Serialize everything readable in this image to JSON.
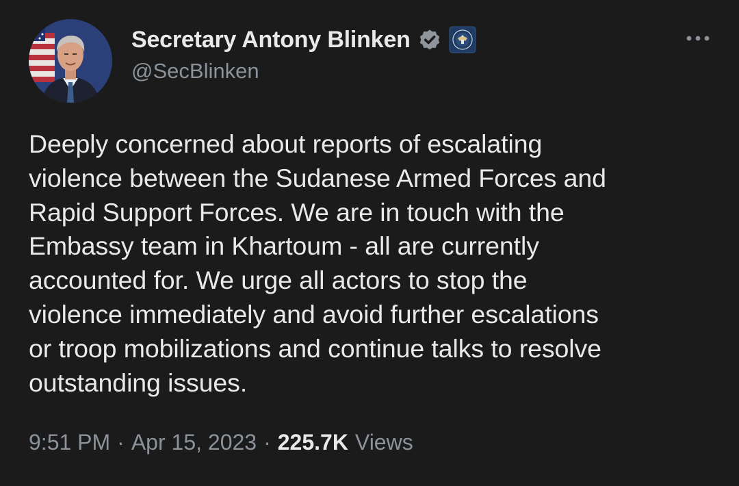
{
  "author": {
    "display_name": "Secretary Antony Blinken",
    "handle": "@SecBlinken",
    "verified_badge_icon": "verified-gray-badge-icon",
    "affiliation_icon": "us-state-department-seal-icon"
  },
  "tweet": {
    "text": "Deeply concerned about reports of escalating\nviolence between the Sudanese Armed Forces and\nRapid Support Forces. We are in touch with the\nEmbassy team in Khartoum - all are currently\naccounted for. We urge all actors to stop the\nviolence immediately and avoid further escalations\nor troop mobilizations and continue talks to resolve\noutstanding issues.",
    "time": "9:51 PM",
    "separator": "·",
    "date": "Apr 15, 2023",
    "views_count": "225.7K",
    "views_label": "Views"
  },
  "menu": {
    "icon": "more-options-icon"
  },
  "colors": {
    "background": "#1b1b1b",
    "primary_text": "#e7e9ea",
    "secondary_text": "#8b9299",
    "badge_gray": "#8e959c"
  }
}
